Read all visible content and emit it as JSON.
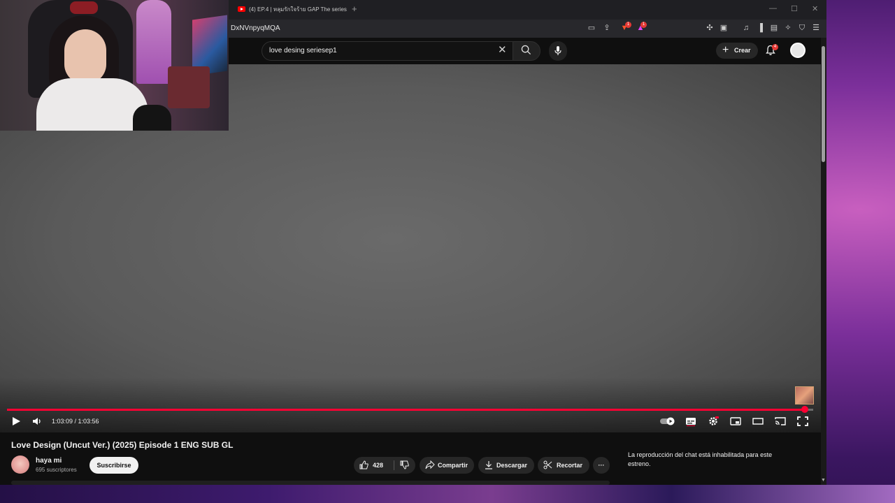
{
  "browser": {
    "tab_title": "(4) EP.4 | หลุมรักใจร้าย GAP The series",
    "url_fragment": "DxNVnpyqMQA",
    "brave_badge": "1",
    "extension_badge": "1"
  },
  "youtube": {
    "search_value": "love desing seriesep1",
    "create_label": "Crear",
    "notifications_count": "4"
  },
  "player": {
    "time_display": "1:03:09 / 1:03:56",
    "progress_fraction": 0.988,
    "paused": true,
    "colors": {
      "progress": "#ff0033"
    }
  },
  "video": {
    "title": "Love Design (Uncut Ver.) (2025) Episode 1 ENG SUB GL",
    "channel_name": "haya mi",
    "subscribers": "695 suscriptores",
    "subscribe_label": "Suscribirse",
    "likes": "428",
    "share_label": "Compartir",
    "download_label": "Descargar",
    "clip_label": "Recortar",
    "more_label": "···"
  },
  "chat": {
    "message": "La reproducción del chat está inhabilitada para este estreno."
  },
  "icons": [
    "youtube-favicon",
    "search-icon",
    "microphone-icon",
    "bell-icon",
    "play-icon",
    "volume-icon",
    "subtitles-icon",
    "settings-icon",
    "miniplayer-icon",
    "theater-icon",
    "cast-icon",
    "fullscreen-icon",
    "like-icon",
    "dislike-icon",
    "share-icon",
    "download-icon",
    "scissors-icon"
  ]
}
